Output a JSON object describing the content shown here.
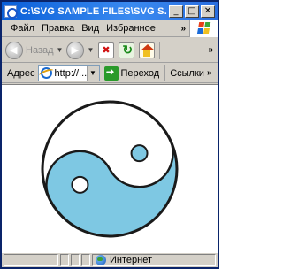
{
  "window": {
    "title": "C:\\SVG SAMPLE FILES\\SVG S...",
    "min_glyph": "_",
    "max_glyph": "□",
    "close_glyph": "✕"
  },
  "menu": {
    "items": [
      "Файл",
      "Правка",
      "Вид",
      "Избранное"
    ],
    "more": "»"
  },
  "toolbar": {
    "back_label": "Назад",
    "more": "»"
  },
  "address": {
    "label": "Адрес",
    "value": "http://...",
    "go_label": "Переход",
    "links_label": "Ссылки",
    "more": "»"
  },
  "status": {
    "zone_label": "Интернет"
  },
  "colors": {
    "yin_yang_light": "#7ec8e3",
    "yin_yang_dark": "#ffffff",
    "outline": "#1a1a1a",
    "titlebar": "#0a5fd8"
  },
  "content": {
    "figure": "yin-yang"
  }
}
